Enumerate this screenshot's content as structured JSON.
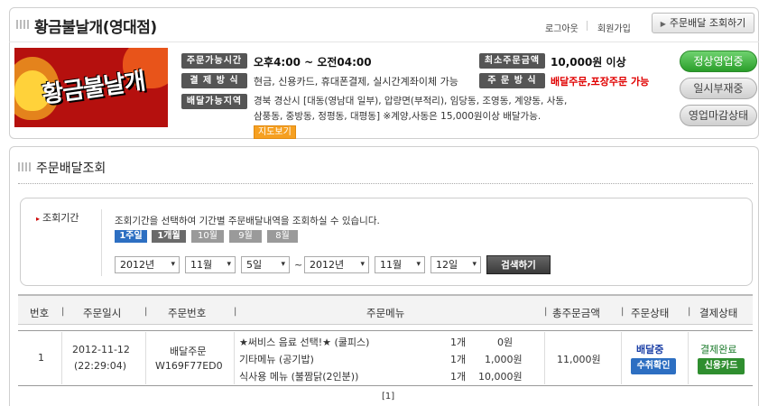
{
  "store": {
    "title": "황금불날개(영대점)",
    "logo_text": "황금불날개",
    "links": {
      "logout": "로그아웃",
      "signup": "회원가입"
    },
    "order_lookup_button": "주문배달 조회하기"
  },
  "info": {
    "hours_label": "주문가능시간",
    "hours_value": "오후4:00 ~ 오전04:00",
    "payment_label": "결 제 방 식",
    "payment_value": "현금, 신용카드, 휴대폰결제, 실시간계좌이체 가능",
    "area_label": "배달가능지역",
    "area_value": "경북 경산시 [대동(영남대 일부), 압량면(부적리), 임당동, 조영동, 계양동, 사동, 삼풍동, 중방동, 정평동, 대평동] ※계양,사동은 15,000원이상 배달가능.",
    "map_button": "지도보기",
    "min_order_label": "최소주문금액",
    "min_order_value": "10,000원 이상",
    "order_method_label": "주 문 방 식",
    "order_method_value": "배달주문,포장주문 가능"
  },
  "status_buttons": {
    "open": "정상영업중",
    "pause": "일시부재중",
    "closed": "영업마감상태"
  },
  "lookup": {
    "title": "주문배달조회",
    "period_label": "조회기간",
    "description": "조회기간을 선택하여 기간별 주문배달내역을 조회하실 수 있습니다.",
    "periods": [
      "1주일",
      "1개월",
      "10월",
      "9월",
      "8월"
    ],
    "from": {
      "year": "2012년",
      "month": "11월",
      "day": "5일"
    },
    "tilde": "~",
    "to": {
      "year": "2012년",
      "month": "11월",
      "day": "12일"
    },
    "search_button": "검색하기"
  },
  "table": {
    "headers": [
      "번호",
      "주문일시",
      "주문번호",
      "주문메뉴",
      "총주문금액",
      "주문상태",
      "결제상태"
    ],
    "separator": "|",
    "row": {
      "number": "1",
      "date": "2012-11-12",
      "time": "(22:29:04)",
      "order_type": "배달주문",
      "order_id": "W169F77ED0",
      "menu": [
        {
          "name": "★써비스 음료 선택!★ (쿨피스)",
          "qty": "1개",
          "price": "0원"
        },
        {
          "name": "기타메뉴 (공기밥)",
          "qty": "1개",
          "price": "1,000원"
        },
        {
          "name": "식사용 메뉴 (불짬닭(2인분))",
          "qty": "1개",
          "price": "10,000원"
        }
      ],
      "total": "11,000원",
      "order_status": "배달중",
      "cancel_button": "수취확인",
      "payment_status": "결제완료",
      "payment_method": "신용카드"
    }
  },
  "pagination": "[1]"
}
